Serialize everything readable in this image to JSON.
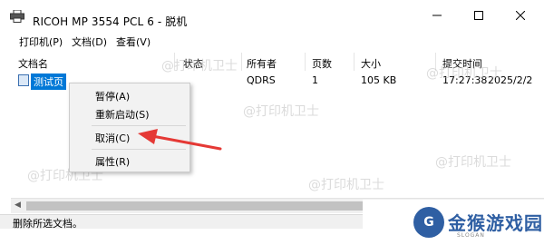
{
  "window": {
    "title": "RICOH MP 3554 PCL 6 - 脱机"
  },
  "menu": [
    "打印机(P)",
    "文档(D)",
    "查看(V)"
  ],
  "columns": [
    "文档名",
    "状态",
    "所有者",
    "页数",
    "大小",
    "提交时间"
  ],
  "job": {
    "name": "测试页",
    "owner": "QDRS",
    "pages": "1",
    "size": "105 KB",
    "submitted_time": "17:27:38",
    "submitted_date": "2025/2/2"
  },
  "context_menu": {
    "items": [
      "暂停(A)",
      "重新启动(S)",
      "取消(C)",
      "属性(R)"
    ]
  },
  "status_text": "删除所选文档。",
  "watermarks": [
    "@打印机卫士",
    "@打印机卫士",
    "@打印机卫士",
    "@打印机卫士",
    "@打印机卫士",
    "@打印机卫士"
  ],
  "brand": {
    "name": "金猴游戏园",
    "tagline": "SLOGAN"
  },
  "colors": {
    "selection": "#0078d7",
    "arrow": "#e53935",
    "brand": "#2f5fa3"
  }
}
